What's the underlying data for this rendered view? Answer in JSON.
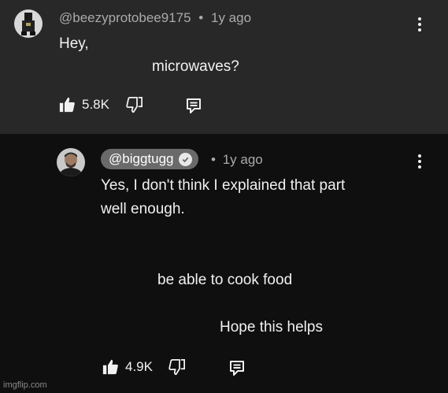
{
  "comment": {
    "username": "@beezyprotobee9175",
    "separator": "•",
    "time": "1y ago",
    "lines": [
      "Hey,",
      "microwaves?"
    ],
    "likes": "5.8K"
  },
  "reply": {
    "username": "@biggtugg",
    "separator": "•",
    "time": "1y ago",
    "lines": [
      "Yes, I don't think I explained that part",
      "well enough.",
      "be able to cook food",
      "Hope this helps"
    ],
    "likes": "4.9K"
  },
  "watermark": "imgflip.com",
  "colors": {
    "top_bg": "#282828",
    "bottom_bg": "#0f0f0f",
    "chip_bg": "#6a6a6a",
    "meta_text": "#aaaaaa"
  }
}
